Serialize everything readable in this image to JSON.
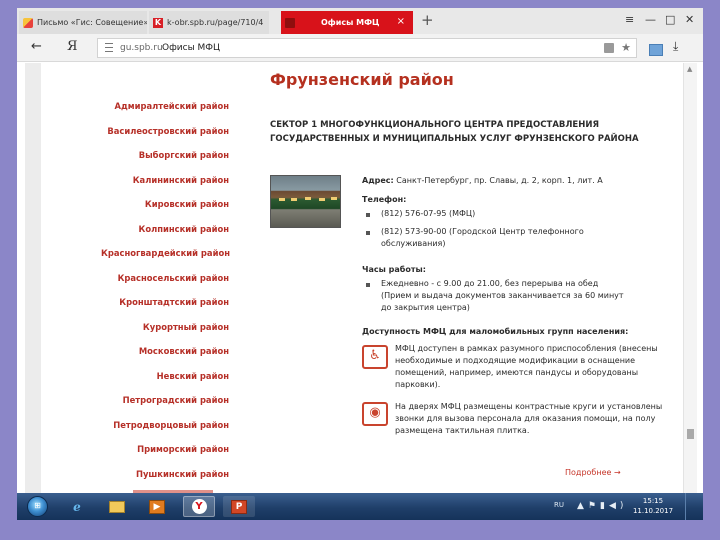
{
  "browser": {
    "tabs": [
      {
        "label": "Письмо «Гис: Совещение»"
      },
      {
        "label": "k-obr.spb.ru/page/710/4"
      },
      {
        "label": "Офисы МФЦ",
        "active": true
      }
    ],
    "new_tab": "+",
    "close_tab": "×",
    "window_controls": {
      "menu": "≡",
      "minimize": "—",
      "maximize": "□",
      "close": "✕"
    },
    "back": "←",
    "yandex_logo": "Я",
    "url_domain": "gu.spb.ru",
    "url_title": "Офисы МФЦ",
    "download": "⤓"
  },
  "sidebar": {
    "districts": [
      "Адмиралтейский район",
      "Василеостровский район",
      "Выборгский район",
      "Калининский район",
      "Кировский район",
      "Колпинский район",
      "Красногвардейский район",
      "Красносельский район",
      "Кронштадтский район",
      "Курортный район",
      "Московский район",
      "Невский район",
      "Петроградский район",
      "Петродворцовый район",
      "Приморский район",
      "Пушкинский район"
    ]
  },
  "main": {
    "district_title": "Фрунзенский район",
    "sector_title": "СЕКТОР 1 МНОГОФУНКЦИОНАЛЬНОГО ЦЕНТРА ПРЕДОСТАВЛЕНИЯ ГОСУДАРСТВЕННЫХ И МУНИЦИПАЛЬНЫХ УСЛУГ ФРУНЗЕНСКОГО РАЙОНА",
    "address_label": "Адрес:",
    "address_value": "Санкт-Петербург, пр. Славы, д. 2, корп. 1, лит. А",
    "phone_label": "Телефон:",
    "phones": [
      "(812) 576-07-95 (МФЦ)",
      "(812) 573-90-00 (Городской Центр телефонного обслуживания)"
    ],
    "hours_label": "Часы работы:",
    "hours": "Ежедневно - с 9.00 до 21.00, без перерыва на обед (Прием и выдача документов заканчивается за 60 минут до закрытия центра)",
    "access_label": "Доступность МФЦ для маломобильных групп населения:",
    "access_items": [
      {
        "icon": "wheelchair-icon",
        "text": "МФЦ доступен в рамках разумного приспособления (внесены необходимые и подходящие модификации в оснащение помещений, например, имеются пандусы и оборудованы парковки)."
      },
      {
        "icon": "low-vision-icon",
        "text": "На дверях МФЦ размещены контрастные круги и установлены звонки для вызова персонала для оказания помощи, на полу размещена тактильная плитка."
      }
    ],
    "more_link": "Подробнее →"
  },
  "taskbar": {
    "start": "⊞",
    "lang": "RU",
    "tray_icons": "▲⚑▮◀)",
    "time": "15:15",
    "date": "11.10.2017"
  },
  "colors": {
    "accent_red": "#d8121a",
    "district_red": "#b63028",
    "title_red": "#b5301f",
    "taskbar_blue": "#1f3f69",
    "page_background": "#ffffff"
  }
}
